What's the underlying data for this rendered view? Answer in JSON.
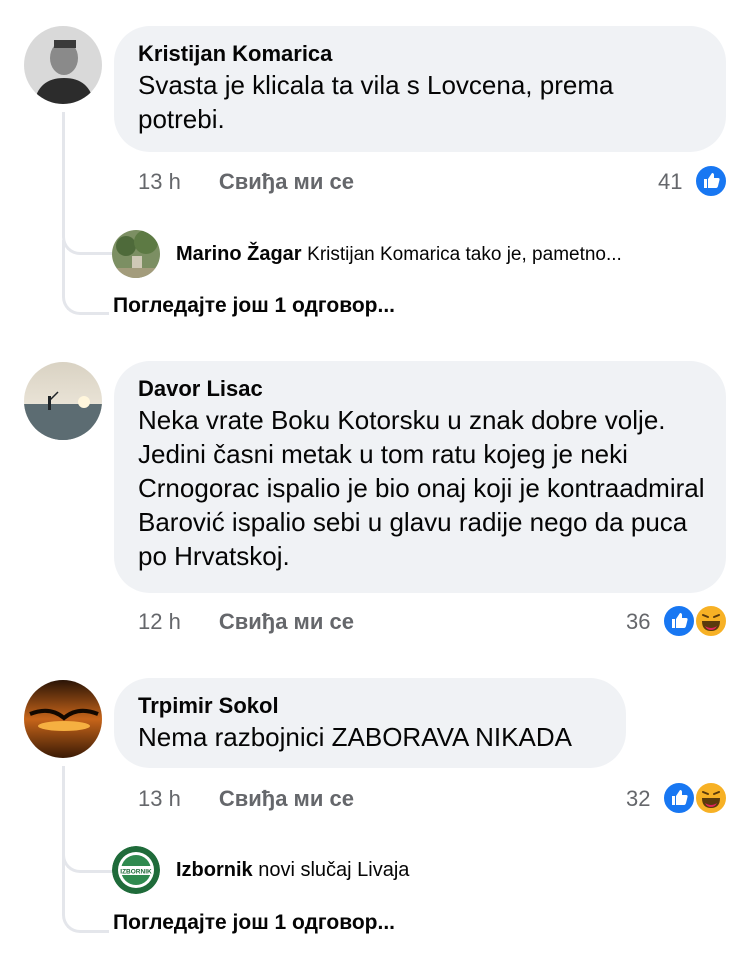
{
  "comments": [
    {
      "author": "Kristijan Komarica",
      "text": "Svasta je klicala ta vila s Lovcena, prema potrebi.",
      "time": "13 h",
      "like_label": "Свиђа ми се",
      "reactions_count": "41",
      "reactions": [
        "like-icon"
      ],
      "reply": {
        "author": "Marino Žagar",
        "text": "Kristijan Komarica tako je, pametno..."
      },
      "more_replies": "Погледајте још 1 одговор..."
    },
    {
      "author": "Davor Lisac",
      "text": "Neka vrate Boku Kotorsku u znak dobre volje. Jedini časni metak u tom ratu kojeg je neki Crnogorac ispalio je bio onaj koji je kontraadmiral Barović ispalio sebi u glavu radije nego da puca po Hrvatskoj.",
      "time": "12 h",
      "like_label": "Свиђа ми се",
      "reactions_count": "36",
      "reactions": [
        "like-icon",
        "haha-icon"
      ]
    },
    {
      "author": "Trpimir Sokol",
      "text": "Nema razbojnici ZABORAVA NIKADA",
      "time": "13 h",
      "like_label": "Свиђа ми се",
      "reactions_count": "32",
      "reactions": [
        "like-icon",
        "haha-icon"
      ],
      "reply": {
        "author": "Izbornik",
        "text": "novi slučaj Livaja",
        "logo_text": "IZBORNIK"
      },
      "more_replies": "Погледајте још 1 одговор..."
    }
  ],
  "colors": {
    "like_blue": "#1877f2",
    "haha_yellow": "#f7b125",
    "bubble": "#f0f2f5",
    "meta_gray": "#65676b"
  }
}
